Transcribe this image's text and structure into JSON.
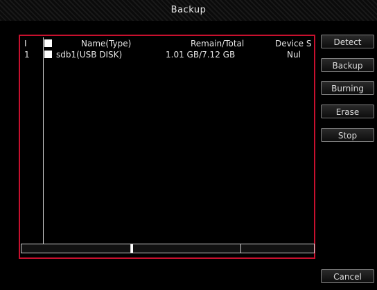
{
  "window": {
    "title": "Backup"
  },
  "table": {
    "headers": {
      "no": "I",
      "name": "Name(Type)",
      "remain": "Remain/Total",
      "device": "Device S"
    },
    "rows": [
      {
        "no": "1",
        "name": "sdb1(USB DISK)",
        "remain": "1.01 GB/7.12 GB",
        "device": "Nul"
      }
    ]
  },
  "buttons": {
    "detect": "Detect",
    "backup": "Backup",
    "burning": "Burning",
    "erase": "Erase",
    "stop": "Stop",
    "cancel": "Cancel"
  }
}
